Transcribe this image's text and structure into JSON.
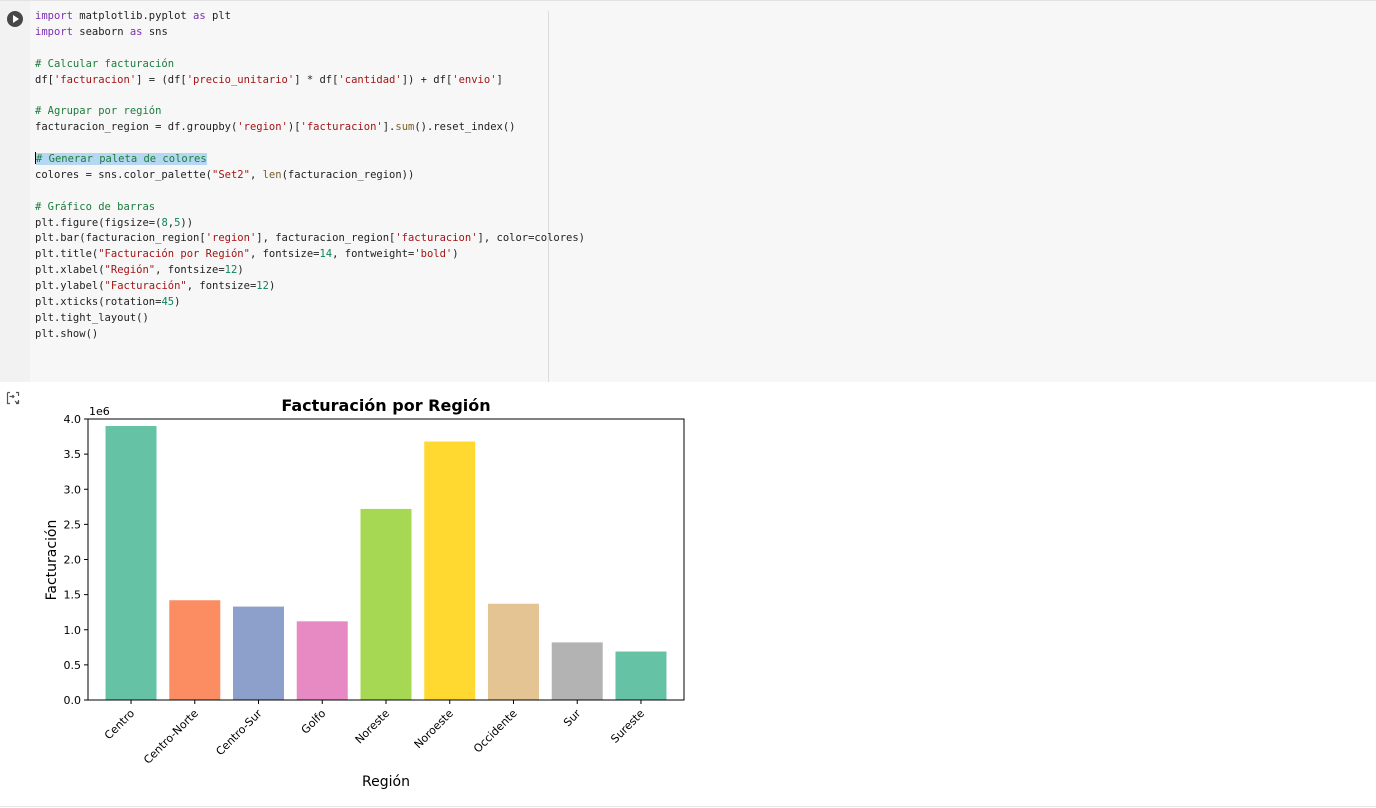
{
  "code_cell": {
    "run_button_label": "Run cell",
    "lines": [
      [
        {
          "t": "import",
          "c": "kw"
        },
        {
          "t": " matplotlib.pyplot "
        },
        {
          "t": "as",
          "c": "kw"
        },
        {
          "t": " plt"
        }
      ],
      [
        {
          "t": "import",
          "c": "kw"
        },
        {
          "t": " seaborn "
        },
        {
          "t": "as",
          "c": "kw"
        },
        {
          "t": " sns"
        }
      ],
      [],
      [
        {
          "t": "# Calcular facturación",
          "c": "cm"
        }
      ],
      [
        {
          "t": "df["
        },
        {
          "t": "'facturacion'",
          "c": "st"
        },
        {
          "t": "] = (df["
        },
        {
          "t": "'precio_unitario'",
          "c": "st"
        },
        {
          "t": "] * df["
        },
        {
          "t": "'cantidad'",
          "c": "st"
        },
        {
          "t": "]) + df["
        },
        {
          "t": "'envio'",
          "c": "st"
        },
        {
          "t": "]"
        }
      ],
      [],
      [
        {
          "t": "# Agrupar por región",
          "c": "cm"
        }
      ],
      [
        {
          "t": "facturacion_region = df.groupby("
        },
        {
          "t": "'region'",
          "c": "st"
        },
        {
          "t": ")["
        },
        {
          "t": "'facturacion'",
          "c": "st"
        },
        {
          "t": "]."
        },
        {
          "t": "sum",
          "c": "fn"
        },
        {
          "t": "().reset_index()"
        }
      ],
      [],
      [
        {
          "t": "# Generar paleta de colores",
          "c": "cm hl",
          "caret": true
        }
      ],
      [
        {
          "t": "colores = sns.color_palette("
        },
        {
          "t": "\"Set2\"",
          "c": "st"
        },
        {
          "t": ", "
        },
        {
          "t": "len",
          "c": "fn"
        },
        {
          "t": "(facturacion_region))"
        }
      ],
      [],
      [
        {
          "t": "# Gráfico de barras",
          "c": "cm"
        }
      ],
      [
        {
          "t": "plt.figure(figsize=("
        },
        {
          "t": "8",
          "c": "nu"
        },
        {
          "t": ","
        },
        {
          "t": "5",
          "c": "nu"
        },
        {
          "t": "))"
        }
      ],
      [
        {
          "t": "plt.bar(facturacion_region["
        },
        {
          "t": "'region'",
          "c": "st"
        },
        {
          "t": "], facturacion_region["
        },
        {
          "t": "'facturacion'",
          "c": "st"
        },
        {
          "t": "], color=colores)"
        }
      ],
      [
        {
          "t": "plt.title("
        },
        {
          "t": "\"Facturación por Región\"",
          "c": "st"
        },
        {
          "t": ", fontsize="
        },
        {
          "t": "14",
          "c": "nu"
        },
        {
          "t": ", fontweight="
        },
        {
          "t": "'bold'",
          "c": "st"
        },
        {
          "t": ")"
        }
      ],
      [
        {
          "t": "plt.xlabel("
        },
        {
          "t": "\"Región\"",
          "c": "st"
        },
        {
          "t": ", fontsize="
        },
        {
          "t": "12",
          "c": "nu"
        },
        {
          "t": ")"
        }
      ],
      [
        {
          "t": "plt.ylabel("
        },
        {
          "t": "\"Facturación\"",
          "c": "st"
        },
        {
          "t": ", fontsize="
        },
        {
          "t": "12",
          "c": "nu"
        },
        {
          "t": ")"
        }
      ],
      [
        {
          "t": "plt.xticks(rotation="
        },
        {
          "t": "45",
          "c": "nu"
        },
        {
          "t": ")"
        }
      ],
      [
        {
          "t": "plt.tight_layout()"
        }
      ],
      [
        {
          "t": "plt.show()"
        }
      ]
    ]
  },
  "output": {
    "toggle_icon": "output-toggle-icon"
  },
  "chart_data": {
    "type": "bar",
    "title": "Facturación por Región",
    "xlabel": "Región",
    "ylabel": "Facturación",
    "offset_label": "1e6",
    "categories": [
      "Centro",
      "Centro-Norte",
      "Centro-Sur",
      "Golfo",
      "Noreste",
      "Noroeste",
      "Occidente",
      "Sur",
      "Sureste"
    ],
    "values": [
      3900000,
      1420000,
      1330000,
      1120000,
      2720000,
      3680000,
      1370000,
      820000,
      690000
    ],
    "colors": [
      "#66c2a5",
      "#fc8d62",
      "#8da0cb",
      "#e78ac3",
      "#a6d854",
      "#ffd92f",
      "#e5c494",
      "#b3b3b3",
      "#66c2a5"
    ],
    "ylim": [
      0,
      4000000
    ],
    "yticks": [
      0,
      500000,
      1000000,
      1500000,
      2000000,
      2500000,
      3000000,
      3500000,
      4000000
    ],
    "ytick_labels": [
      "0.0",
      "0.5",
      "1.0",
      "1.5",
      "2.0",
      "2.5",
      "3.0",
      "3.5",
      "4.0"
    ],
    "xtick_rotation": 45,
    "grid": false,
    "legend": "none"
  }
}
